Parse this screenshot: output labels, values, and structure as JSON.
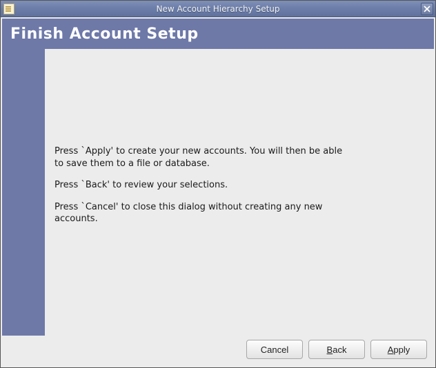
{
  "window": {
    "title": "New Account Hierarchy Setup"
  },
  "header": {
    "title": "Finish Account Setup"
  },
  "body": {
    "paragraph1": "Press `Apply' to create your new accounts.  You will then be able to save them to a file or database.",
    "paragraph2": "Press `Back' to review your selections.",
    "paragraph3": "Press `Cancel' to close this dialog without creating any new accounts."
  },
  "buttons": {
    "cancel": "Cancel",
    "back": "Back",
    "apply": "Apply"
  }
}
